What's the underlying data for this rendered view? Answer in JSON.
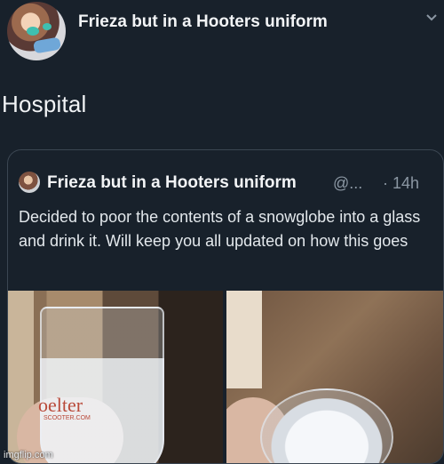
{
  "post": {
    "author": "Frieza but in a Hooters uniform",
    "text": "Hospital"
  },
  "quoted_tweet": {
    "author": "Frieza but in a Hooters uniform",
    "handle": "@...",
    "time": "· 14h",
    "text": "Decided to poor the contents of a snowglobe into a glass and drink it. Will keep you all updated on how this goes",
    "photo_left_brand": "oelter",
    "photo_left_brand_sub": "SCOOTER.COM"
  },
  "watermark": "imgflip.com"
}
